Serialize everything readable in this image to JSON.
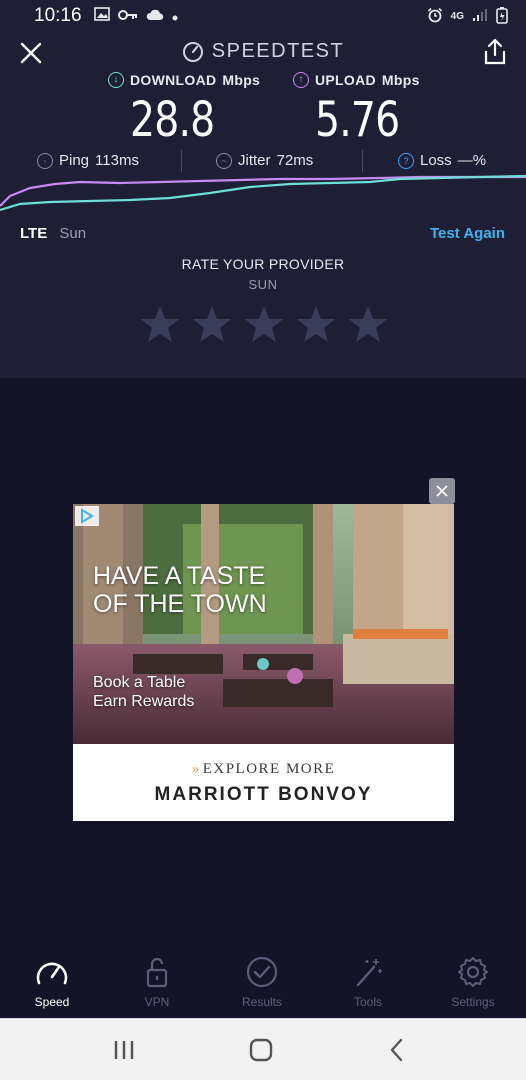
{
  "status_bar": {
    "time": "10:16",
    "network": "4G"
  },
  "app": {
    "title": "SPEEDTEST"
  },
  "results": {
    "download": {
      "label": "DOWNLOAD",
      "unit": "Mbps",
      "value": "28.8",
      "color": "#6ce0d6"
    },
    "upload": {
      "label": "UPLOAD",
      "unit": "Mbps",
      "value": "5.76",
      "color": "#c78af0"
    },
    "ping": {
      "label": "Ping",
      "value": "113ms"
    },
    "jitter": {
      "label": "Jitter",
      "value": "72ms"
    },
    "loss": {
      "label": "Loss",
      "value": "—%"
    }
  },
  "connection": {
    "type": "LTE",
    "provider": "Sun",
    "test_again": "Test Again"
  },
  "rating": {
    "title": "RATE YOUR PROVIDER",
    "provider": "SUN",
    "max_stars": 5,
    "selected": 0
  },
  "ad": {
    "headline_line1": "HAVE A TASTE",
    "headline_line2": "OF THE TOWN",
    "sub_line1": "Book a Table",
    "sub_line2": "Earn Rewards",
    "cta": "EXPLORE MORE",
    "brand": "MARRIOTT BONVOY"
  },
  "tabs": [
    {
      "label": "Speed",
      "icon": "speedometer-icon",
      "active": true
    },
    {
      "label": "VPN",
      "icon": "lock-icon",
      "active": false
    },
    {
      "label": "Results",
      "icon": "check-circle-icon",
      "active": false
    },
    {
      "label": "Tools",
      "icon": "magic-wand-icon",
      "active": false
    },
    {
      "label": "Settings",
      "icon": "gear-icon",
      "active": false
    }
  ],
  "colors": {
    "accent": "#3ab3f0",
    "panel": "#1e1e35",
    "background": "#141428"
  }
}
